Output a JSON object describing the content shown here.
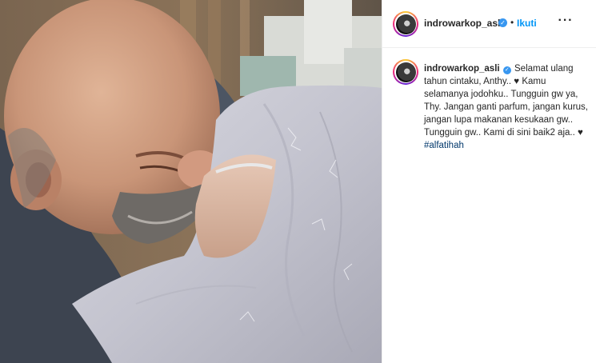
{
  "post": {
    "username": "indrowarkop_asli",
    "verified_icon": "verified-badge-icon",
    "separator": "•",
    "follow_label": "Ikuti",
    "more_label": "···",
    "caption": {
      "username": "indrowarkop_asli",
      "text": "Selamat ulang tahun cintaku, Anthy.. ♥ Kamu selamanya jodohku.. Tungguin gw ya, Thy. Jangan ganti parfum, jangan kurus, jangan lupa makanan kesukaan gw.. Tungguin gw.. Kami di sini baik2 aja.. ♥",
      "hashtag": "#alfatihah"
    }
  },
  "colors": {
    "accent": "#0095f6",
    "verified": "#3897f0",
    "hashtag": "#00376b"
  }
}
